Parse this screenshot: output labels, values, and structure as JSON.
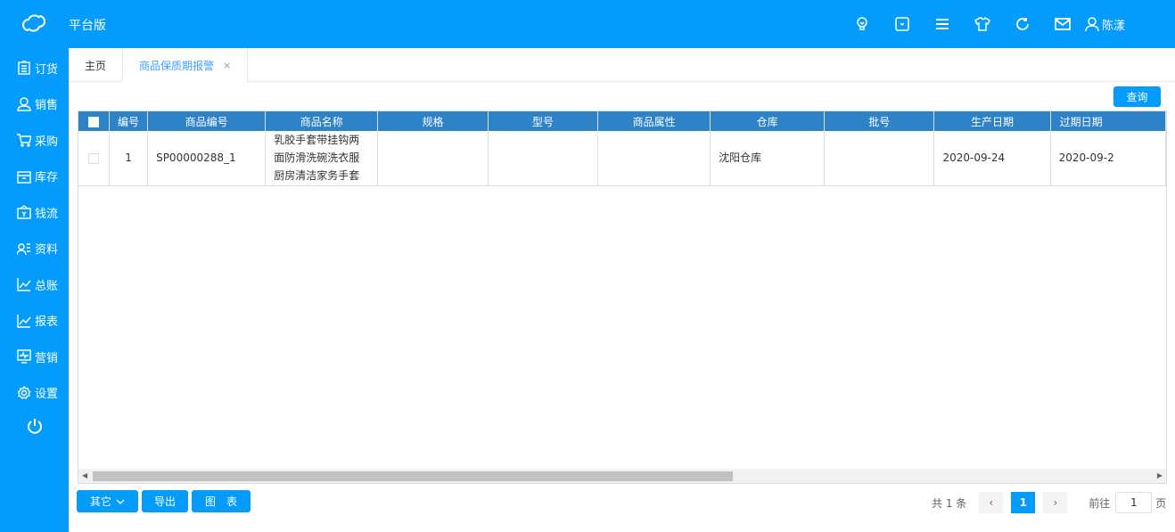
{
  "header": {
    "brand": "平台版",
    "user": "陈漾",
    "icons": [
      "lightbulb-icon",
      "dropdown-box-icon",
      "menu-icon",
      "shirt-icon",
      "refresh-icon",
      "mail-icon"
    ]
  },
  "sidebar": {
    "items": [
      {
        "label": "订货",
        "icon": "clipboard-icon"
      },
      {
        "label": "销售",
        "icon": "user-icon"
      },
      {
        "label": "采购",
        "icon": "cart-icon"
      },
      {
        "label": "库存",
        "icon": "box-icon"
      },
      {
        "label": "钱流",
        "icon": "wallet-icon"
      },
      {
        "label": "资料",
        "icon": "contact-card-icon"
      },
      {
        "label": "总账",
        "icon": "chart-icon"
      },
      {
        "label": "报表",
        "icon": "chart-icon"
      },
      {
        "label": "营销",
        "icon": "monitor-icon"
      },
      {
        "label": "设置",
        "icon": "gear-icon"
      }
    ]
  },
  "tabs": [
    {
      "label": "主页"
    },
    {
      "label": "商品保质期报警",
      "close": "×"
    }
  ],
  "toolbar": {
    "query": "查询"
  },
  "table": {
    "headers": [
      "编号",
      "商品编号",
      "商品名称",
      "规格",
      "型号",
      "商品属性",
      "仓库",
      "批号",
      "生产日期",
      "过期日期"
    ],
    "rows": [
      [
        "1",
        "SP00000288_1",
        "乳胶手套带挂钩两面防滑洗碗洗衣服厨房清洁家务手套",
        "",
        "",
        "",
        "沈阳仓库",
        "",
        "2020-09-24",
        "2020-09-2"
      ]
    ]
  },
  "footer": {
    "other": "其它",
    "export": "导出",
    "chart": "图　表"
  },
  "pagination": {
    "total": "共 1 条",
    "current": "1",
    "goto_label": "前往",
    "goto_value": "1",
    "page_suffix": "页"
  }
}
